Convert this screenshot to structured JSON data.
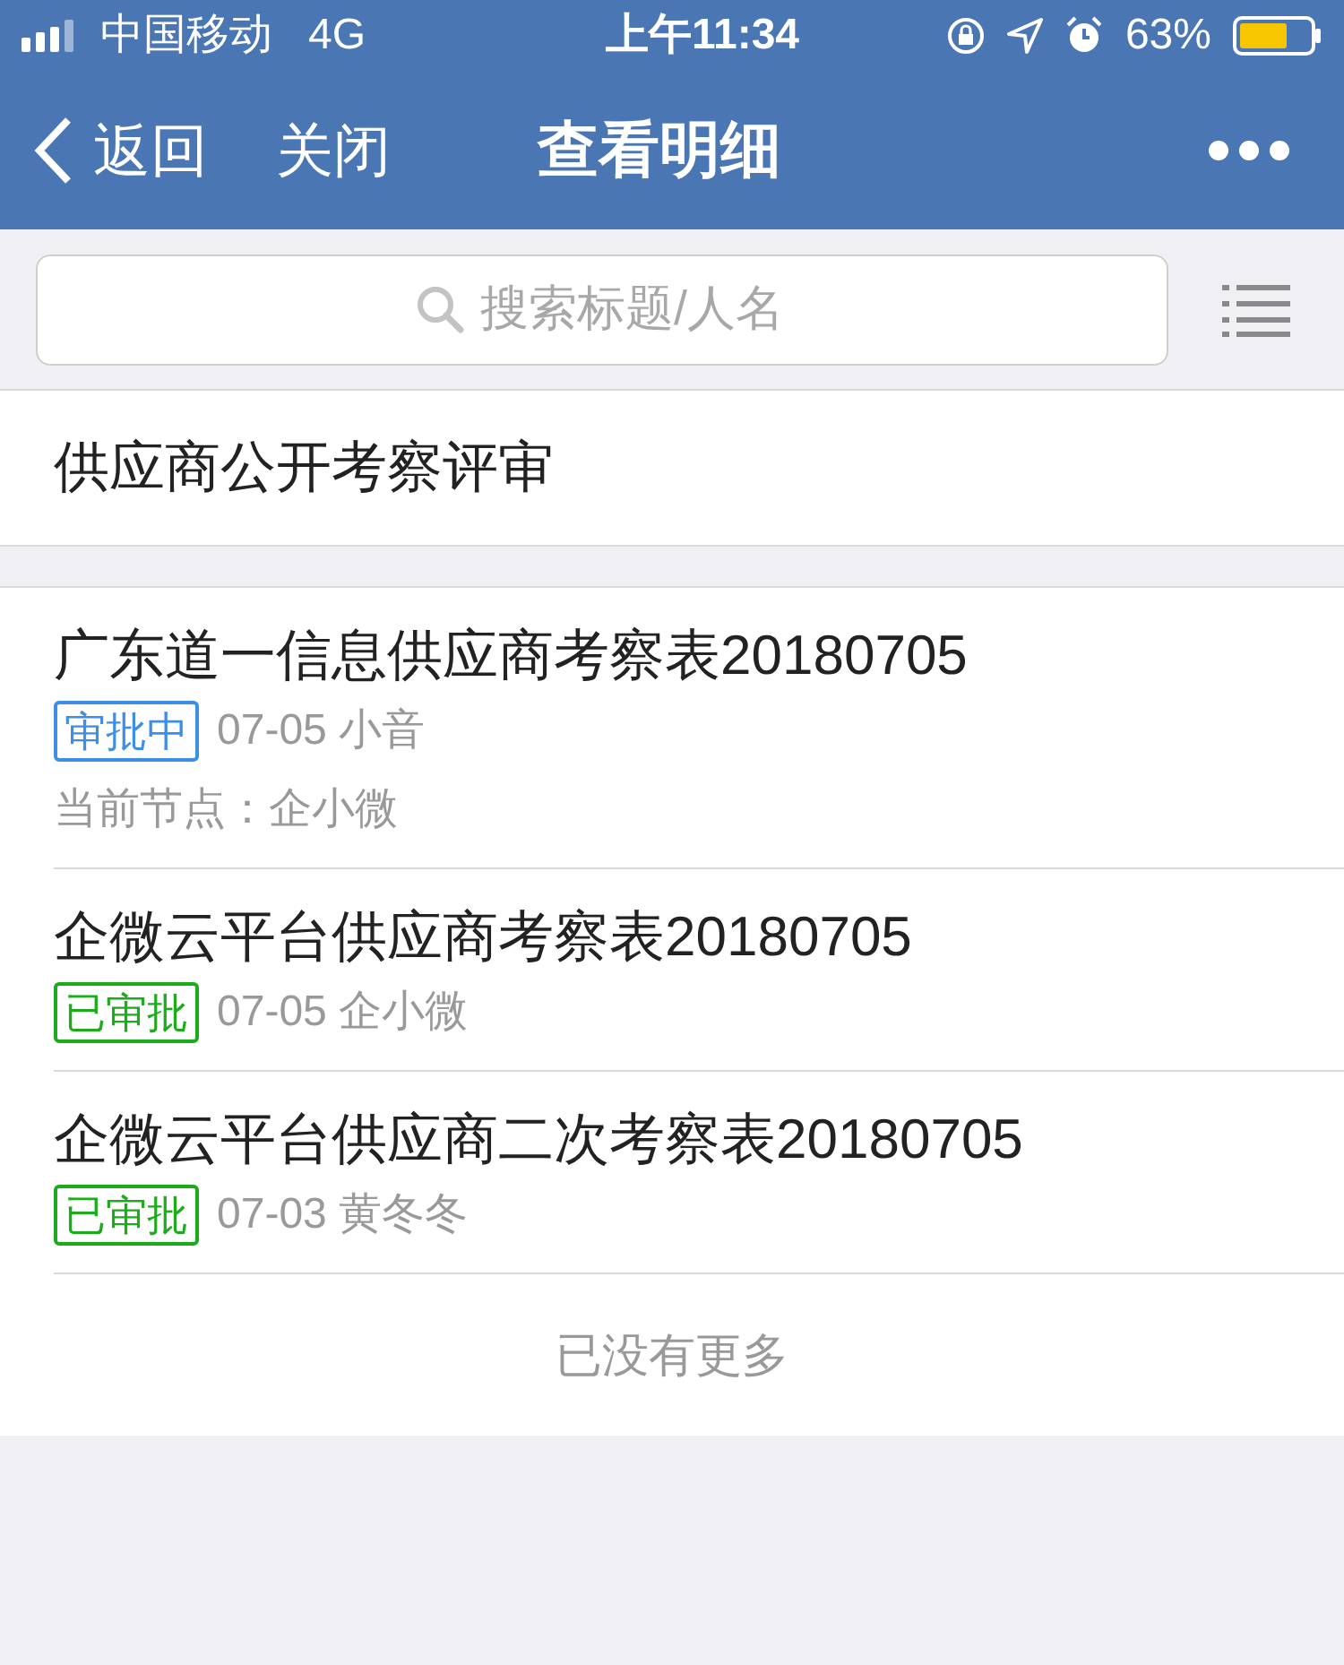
{
  "status_bar": {
    "carrier": "中国移动",
    "network": "4G",
    "time": "上午11:34",
    "battery": "63%"
  },
  "nav": {
    "back": "返回",
    "close": "关闭",
    "title": "查看明细"
  },
  "search": {
    "placeholder": "搜索标题/人名"
  },
  "section": {
    "title": "供应商公开考察评审"
  },
  "items": [
    {
      "title": "广东道一信息供应商考察表20180705",
      "tag": {
        "text": "审批中",
        "color": "#3d8ee6"
      },
      "meta": "07-05 小音",
      "node": "当前节点：企小微"
    },
    {
      "title": "企微云平台供应商考察表20180705",
      "tag": {
        "text": "已审批",
        "color": "#1aad19"
      },
      "meta": "07-05 企小微"
    },
    {
      "title": "企微云平台供应商二次考察表20180705",
      "tag": {
        "text": "已审批",
        "color": "#1aad19"
      },
      "meta": "07-03 黄冬冬"
    }
  ],
  "footer": "已没有更多"
}
